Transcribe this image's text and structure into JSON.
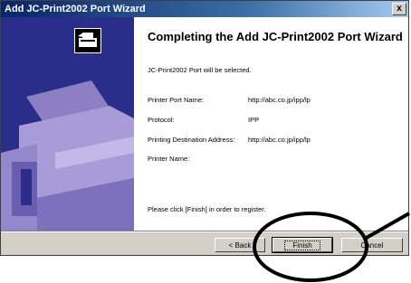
{
  "window": {
    "title": "Add JC-Print2002 Port Wizard",
    "close_label": "x"
  },
  "main": {
    "heading": "Completing the Add JC-Print2002 Port Wizard",
    "selected_text": "JC-Print2002 Port will be selected.",
    "fields": [
      {
        "label": "Printer Port Name:",
        "value": "http://abc.co.jp/ipp/lp"
      },
      {
        "label": "Protocol:",
        "value": "IPP"
      },
      {
        "label": "Printing Destination Address:",
        "value": "http://abc.co.jp/ipp/lp"
      },
      {
        "label": "Printer Name:",
        "value": ""
      }
    ],
    "instruction": "Please click [Finish] in order to register."
  },
  "buttons": {
    "back": "< Back",
    "finish": "Finish",
    "cancel": "Cancel"
  },
  "colors": {
    "sidebar": "#2b2d8a",
    "annotation": "#000000"
  }
}
